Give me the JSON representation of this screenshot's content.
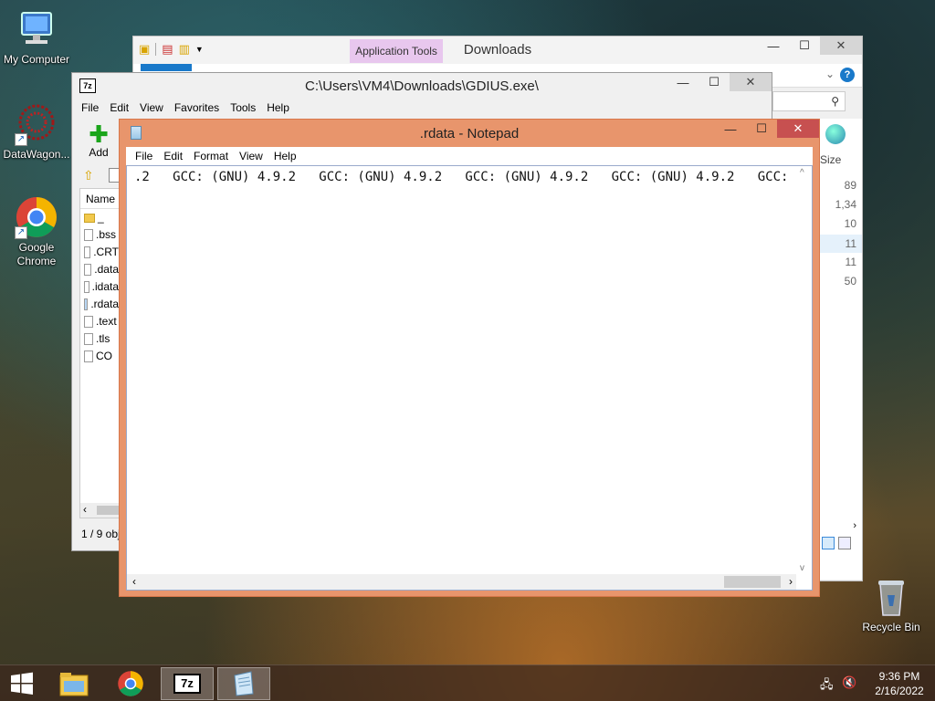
{
  "desktop": {
    "icons": [
      {
        "label": "My Computer"
      },
      {
        "label": "DataWagon..."
      },
      {
        "label": "Google Chrome"
      },
      {
        "label": "Recycle Bin"
      }
    ]
  },
  "explorer": {
    "title": "Downloads",
    "context_tab": "Application Tools",
    "size_header": "Size",
    "sizes": [
      "89",
      "1,34",
      "10",
      "11",
      "11",
      "50"
    ]
  },
  "zip": {
    "app_icon_text": "7z",
    "title": "C:\\Users\\VM4\\Downloads\\GDIUS.exe\\",
    "menu": [
      "File",
      "Edit",
      "View",
      "Favorites",
      "Tools",
      "Help"
    ],
    "add_label": "Add",
    "column_name": "Name",
    "files": [
      "_",
      ".bss",
      ".CRT",
      ".data",
      ".idata",
      ".rdata",
      ".text",
      ".tls",
      "CO"
    ],
    "status": "1 / 9 obj"
  },
  "notepad": {
    "title": ".rdata - Notepad",
    "menu": [
      "File",
      "Edit",
      "Format",
      "View",
      "Help"
    ],
    "content": ".2   GCC: (GNU) 4.9.2   GCC: (GNU) 4.9.2   GCC: (GNU) 4.9.2   GCC: (GNU) 4.9.2   GCC:"
  },
  "taskbar": {
    "apps": [
      "File Explorer",
      "Google Chrome",
      "7-Zip",
      "Notepad"
    ],
    "zip_icon_text": "7z",
    "time": "9:36 PM",
    "date": "2/16/2022"
  }
}
